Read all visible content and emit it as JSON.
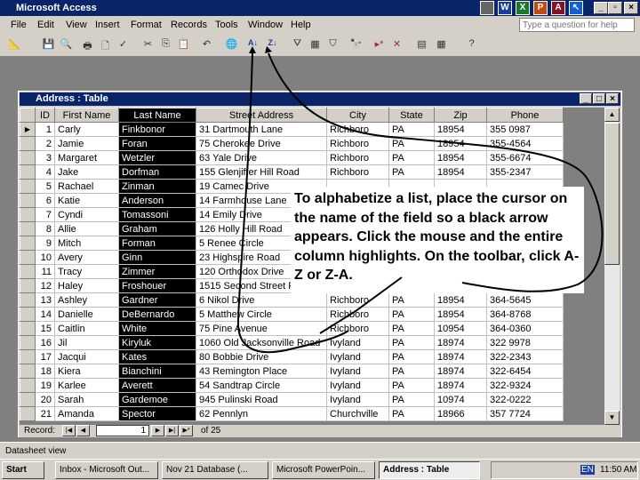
{
  "app": {
    "title": "Microsoft Access",
    "help_placeholder": "Type a question for help"
  },
  "menu": [
    "File",
    "Edit",
    "View",
    "Insert",
    "Format",
    "Records",
    "Tools",
    "Window",
    "Help"
  ],
  "table_window": {
    "title": "Address : Table"
  },
  "columns": [
    "ID",
    "First Name",
    "Last Name",
    "Street Address",
    "City",
    "State",
    "Zip",
    "Phone"
  ],
  "selected_column": "Last Name",
  "rows": [
    [
      "1",
      "Carly",
      "Finkbonor",
      "31 Dartmouth Lane",
      "Richboro",
      "PA",
      "18954",
      "355 0987"
    ],
    [
      "2",
      "Jamie",
      "Foran",
      "75 Cherokee Drive",
      "Richboro",
      "PA",
      "18954",
      "355-4564"
    ],
    [
      "3",
      "Margaret",
      "Wetzler",
      "63 Yale Drive",
      "Richboro",
      "PA",
      "18954",
      "355-6674"
    ],
    [
      "4",
      "Jake",
      "Dorfman",
      "155 Glenjiffer Hill Road",
      "Richboro",
      "PA",
      "18954",
      "355-2347"
    ],
    [
      "5",
      "Rachael",
      "Zinman",
      "19 Camec Drive",
      "",
      "",
      "",
      ""
    ],
    [
      "6",
      "Katie",
      "Anderson",
      "14 Farmhouse Lane",
      "",
      "",
      "",
      ""
    ],
    [
      "7",
      "Cyndi",
      "Tomassoni",
      "14 Emily Drive",
      "",
      "",
      "",
      ""
    ],
    [
      "8",
      "Allie",
      "Graham",
      "126 Holly Hill Road",
      "",
      "",
      "",
      ""
    ],
    [
      "9",
      "Mitch",
      "Forman",
      "5 Renee Circle",
      "",
      "",
      "",
      ""
    ],
    [
      "10",
      "Avery",
      "Ginn",
      "23 Highspire Road",
      "",
      "",
      "",
      ""
    ],
    [
      "11",
      "Tracy",
      "Zimmer",
      "120 Orthodox Drive",
      "",
      "",
      "",
      ""
    ],
    [
      "12",
      "Haley",
      "Froshouer",
      "1515 Second Street Pike",
      "",
      "",
      "",
      ""
    ],
    [
      "13",
      "Ashley",
      "Gardner",
      "6 Nikol Drive",
      "Richboro",
      "PA",
      "18954",
      "364-5645"
    ],
    [
      "14",
      "Danielle",
      "DeBernardo",
      "5 Matthew Circle",
      "Richboro",
      "PA",
      "18954",
      "364-8768"
    ],
    [
      "15",
      "Caitlin",
      "White",
      "75 Pine Avenue",
      "Richboro",
      "PA",
      "10954",
      "364-0360"
    ],
    [
      "16",
      "Jil",
      "Kiryluk",
      "1060 Old Jacksonville Road",
      "Ivyland",
      "PA",
      "18974",
      "322 9978"
    ],
    [
      "17",
      "Jacqui",
      "Kates",
      "80 Bobbie Drive",
      "Ivyland",
      "PA",
      "18974",
      "322-2343"
    ],
    [
      "18",
      "Kiera",
      "Bianchini",
      "43 Remington Place",
      "Ivyland",
      "PA",
      "18974",
      "322-6454"
    ],
    [
      "19",
      "Karlee",
      "Averett",
      "54 Sandtrap Circle",
      "Ivyland",
      "PA",
      "18974",
      "322-9324"
    ],
    [
      "20",
      "Sarah",
      "Gardemoe",
      "945 Pulinski Road",
      "Ivyland",
      "PA",
      "10974",
      "322-0222"
    ],
    [
      "21",
      "Amanda",
      "Spector",
      "62 Pennlyn",
      "Churchville",
      "PA",
      "18966",
      "357 7724"
    ]
  ],
  "nav": {
    "label": "Record:",
    "current": "1",
    "total_label": "of 25"
  },
  "callout": "To alphabetize a list, place the cursor on the name of the field so a black arrow appears. Click the mouse and the entire column highlights.  On the toolbar, click A-Z or Z-A.",
  "status": "Datasheet view",
  "taskbar": {
    "start": "Start",
    "tasks": [
      "Inbox - Microsoft Out...",
      "Nov 21  Database (...",
      "Microsoft PowerPoin...",
      "Address : Table"
    ],
    "clock": "11:50 AM",
    "lang": "EN"
  }
}
